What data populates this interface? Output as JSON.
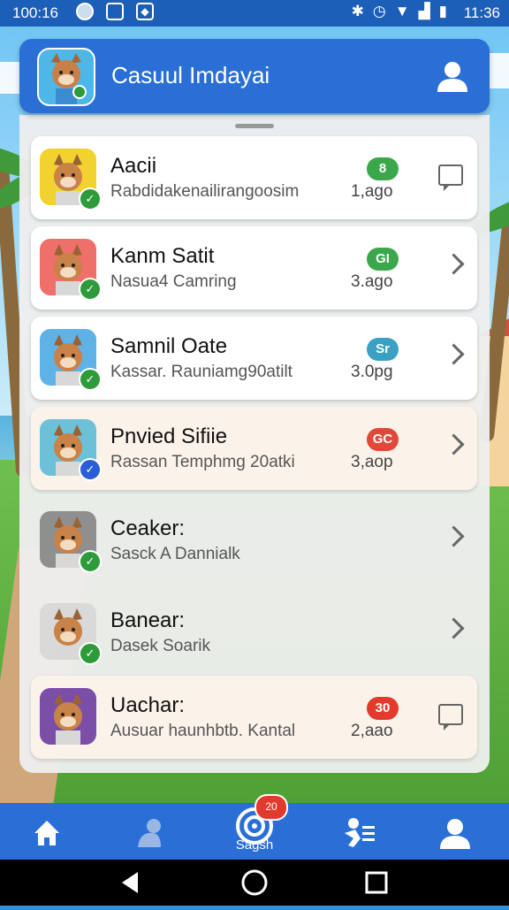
{
  "status_bar": {
    "time_left": "100:16",
    "time_right": "11:36"
  },
  "header": {
    "title": "Casuul Imdayai"
  },
  "conversations": [
    {
      "name": "Aacii",
      "subtitle": "Rabdidakenailirangoosim",
      "badge": "8",
      "badge_color": "#3aa84a",
      "ago": "1,ago",
      "verified": "green",
      "action": "message",
      "style": "card",
      "avatar_bg": "#f2d22e"
    },
    {
      "name": "Kanm Satit",
      "subtitle": "Nasua4 Camring",
      "badge": "GI",
      "badge_color": "#3aa84a",
      "ago": "3.ago",
      "verified": "green",
      "action": "chevron",
      "style": "card",
      "avatar_bg": "#ef6f6a"
    },
    {
      "name": "Samnil Oate",
      "subtitle": "Kassar. Rauniamg90atilt",
      "badge": "Sr",
      "badge_color": "#3aa0c4",
      "ago": "3.0pg",
      "verified": "green",
      "action": "chevron",
      "style": "card",
      "avatar_bg": "#5fb2e6"
    },
    {
      "name": "Pnvied Sifiie",
      "subtitle": "Rassan Temphmg 20atki",
      "badge": "GC",
      "badge_color": "#e0483a",
      "ago": "3,aop",
      "verified": "blue",
      "action": "chevron",
      "style": "warm",
      "avatar_bg": "#6cc0d8"
    },
    {
      "name": "Ceaker:",
      "subtitle": "Sasck A Dannialk",
      "badge": "",
      "badge_color": "",
      "ago": "",
      "verified": "green",
      "action": "chevron",
      "style": "plain",
      "avatar_bg": "#8f8f8f"
    },
    {
      "name": "Banear:",
      "subtitle": "Dasek Soarik",
      "badge": "",
      "badge_color": "",
      "ago": "",
      "verified": "green",
      "action": "chevron",
      "style": "plain",
      "avatar_bg": "#d9d9d9"
    },
    {
      "name": "Uachar:",
      "subtitle": "Ausuar haunhbtb.  Kantal",
      "badge": "30",
      "badge_color": "#e23b2d",
      "ago": "2,aao",
      "verified": "",
      "action": "message",
      "style": "warm",
      "avatar_bg": "#7b4fa8"
    }
  ],
  "bottom_nav": {
    "center_label": "Sagsh",
    "notification_count": "20"
  },
  "colors": {
    "primary": "#2a6fd6",
    "status_bar": "#1c5fb8"
  }
}
